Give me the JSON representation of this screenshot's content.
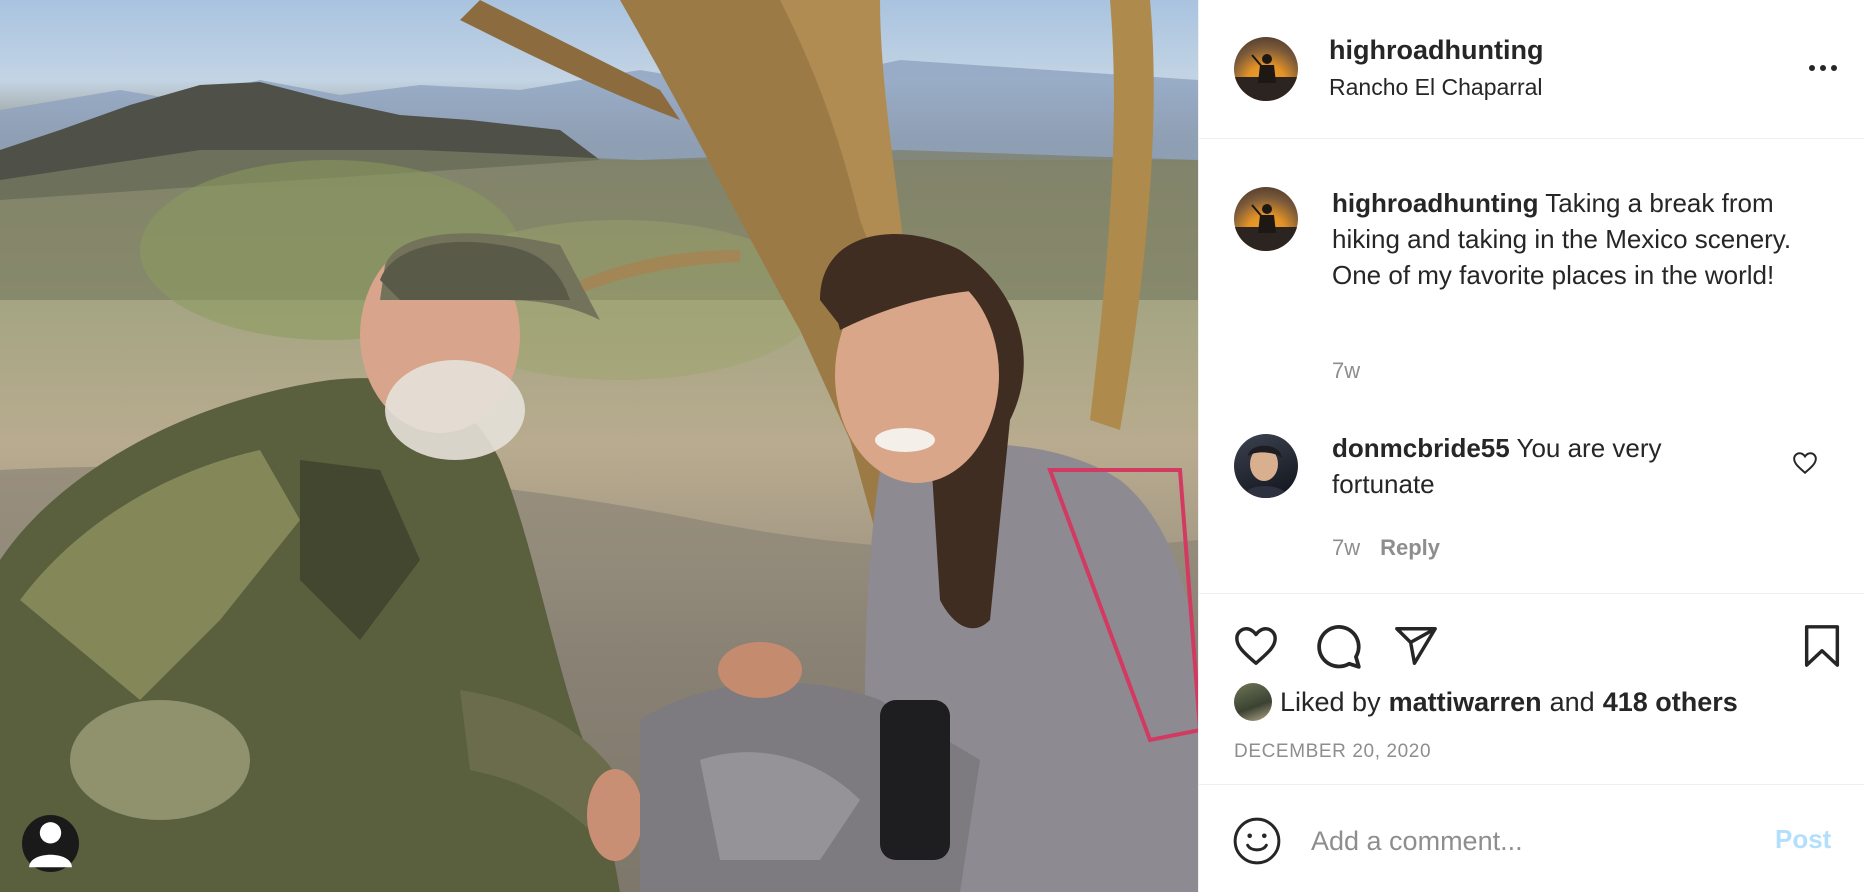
{
  "post": {
    "username": "highroadhunting",
    "location": "Rancho El Chaparral",
    "caption": "Taking a break from hiking and taking in the Mexico scenery. One of my favorite places in the world!",
    "caption_time": "7w",
    "date": "DECEMBER 20, 2020"
  },
  "comments": [
    {
      "username": "donmcbride55",
      "text": "You are very fortunate",
      "time": "7w",
      "reply_label": "Reply"
    }
  ],
  "likes": {
    "prefix": "Liked by",
    "user": "mattiwarren",
    "joiner": "and",
    "others": "418 others"
  },
  "add_comment": {
    "placeholder": "Add a comment...",
    "post_label": "Post"
  },
  "icons": [
    "more-options-icon",
    "heart-icon",
    "comment-icon",
    "share-icon",
    "bookmark-icon",
    "emoji-icon",
    "user-tag-icon"
  ],
  "colors": {
    "text": "#262626",
    "secondary": "#8e8e8e",
    "post_disabled": "#b2dffc",
    "divider": "#efefef"
  }
}
